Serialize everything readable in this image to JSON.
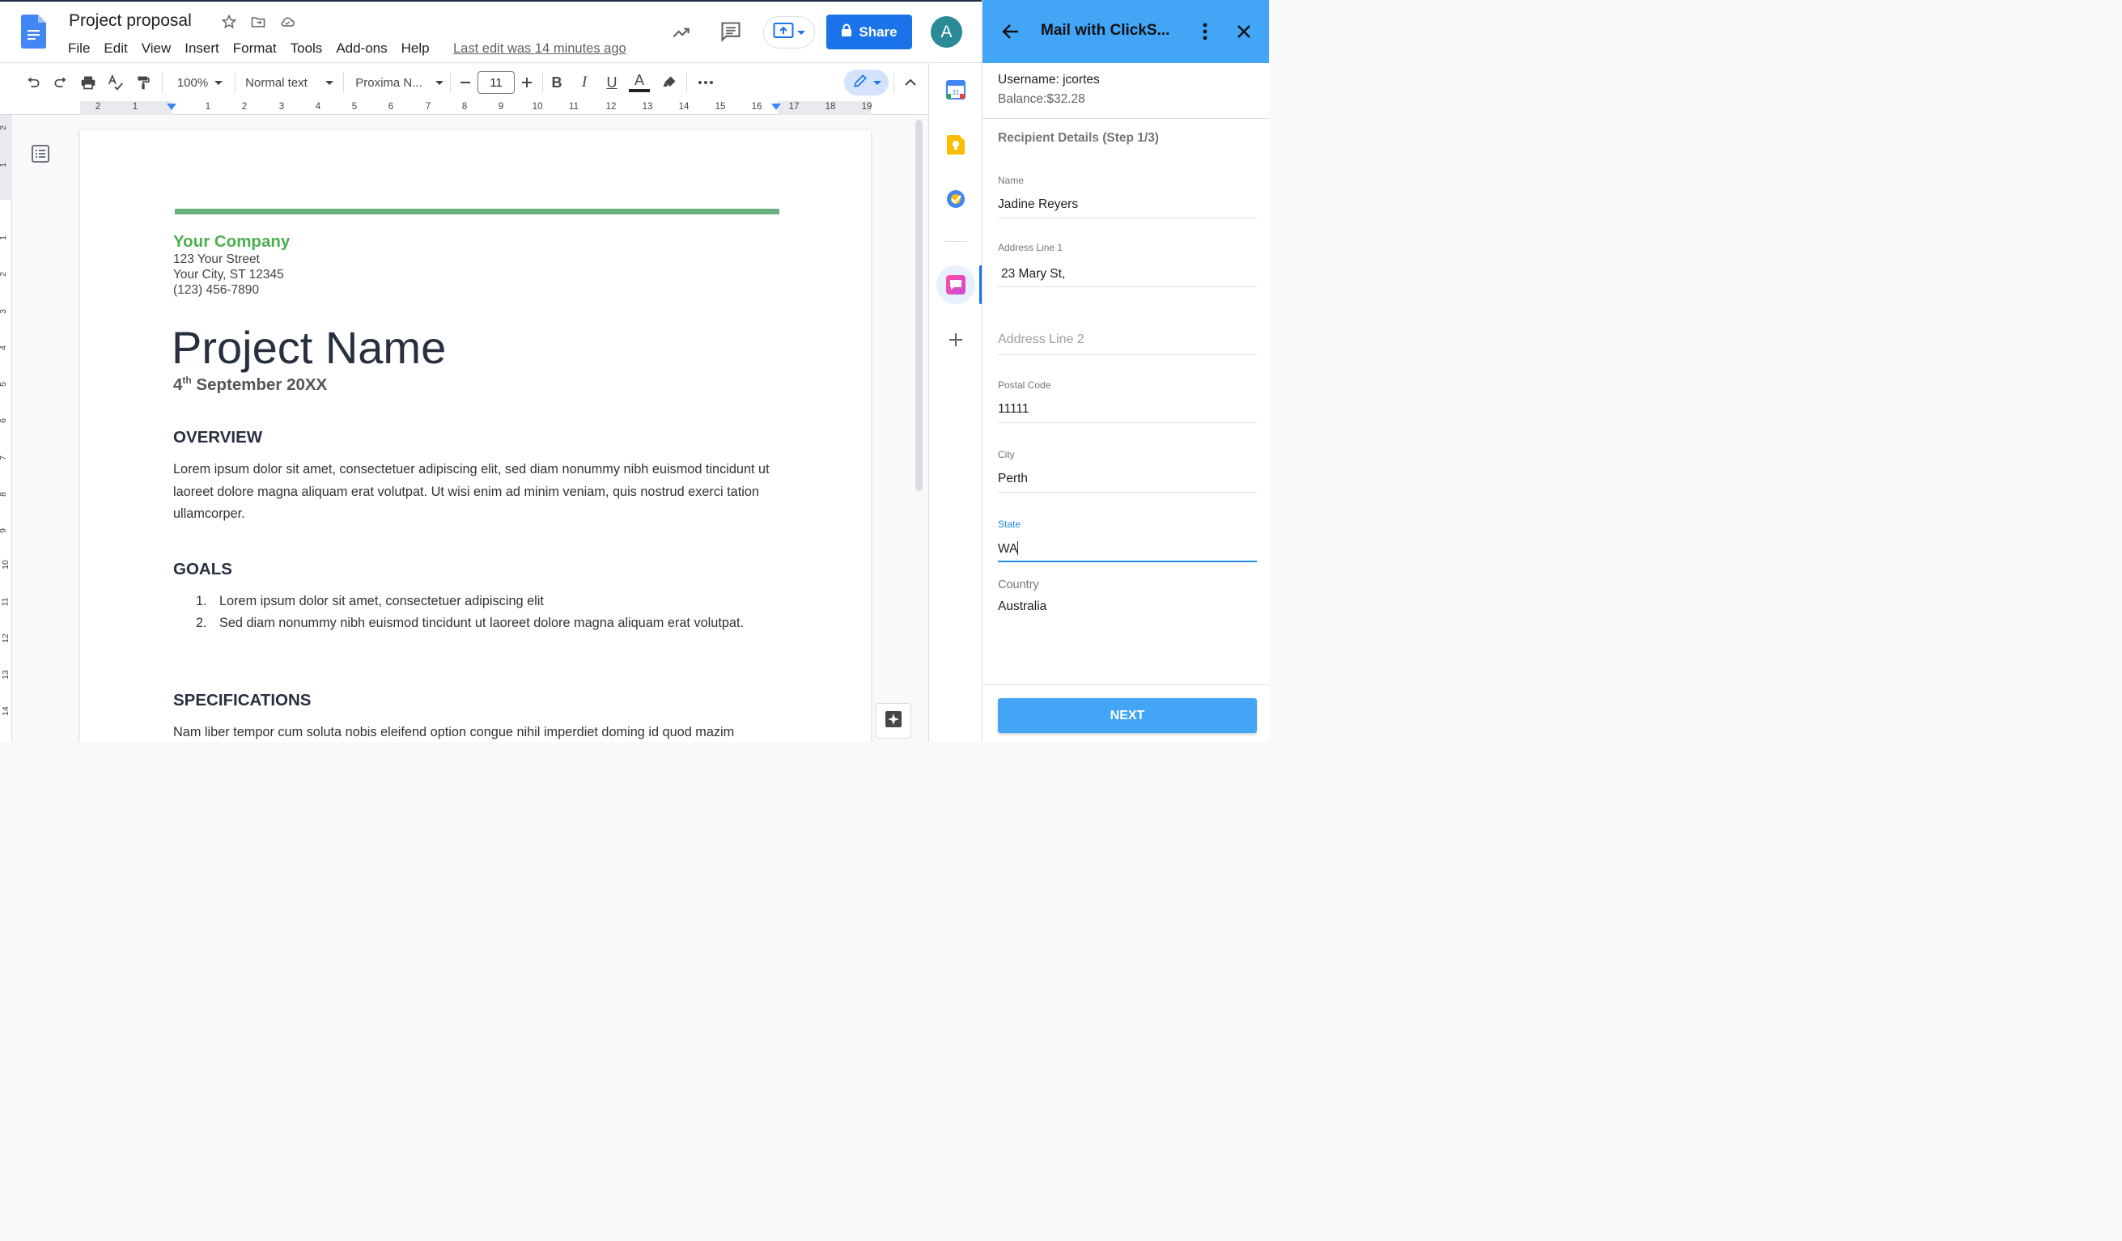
{
  "doc": {
    "title": "Project proposal",
    "menu": [
      "File",
      "Edit",
      "View",
      "Insert",
      "Format",
      "Tools",
      "Add-ons",
      "Help"
    ],
    "last_edit": "Last edit was 14 minutes ago",
    "share_label": "Share",
    "avatar_letter": "A"
  },
  "toolbar": {
    "zoom": "100%",
    "style": "Normal text",
    "font": "Proxima N...",
    "font_size": "11",
    "bold": "B",
    "italic": "I",
    "underline": "U",
    "text_color": "A"
  },
  "ruler": {
    "h_left": [
      "2",
      "1"
    ],
    "h_right": [
      "1",
      "2",
      "3",
      "4",
      "5",
      "6",
      "7",
      "8",
      "9",
      "10",
      "11",
      "12",
      "13",
      "14",
      "15",
      "16",
      "17",
      "18",
      "19"
    ],
    "v": [
      "2",
      "1",
      "1",
      "2",
      "3",
      "4",
      "5",
      "6",
      "7",
      "8",
      "9",
      "10",
      "11",
      "12",
      "13",
      "14"
    ]
  },
  "page": {
    "company": "Your Company",
    "street": "123 Your Street",
    "city": "Your City, ST 12345",
    "phone": "(123) 456-7890",
    "project_name": "Project Name",
    "date_day": "4",
    "date_suffix": "th",
    "date_rest": " September 20XX",
    "overview_heading": "OVERVIEW",
    "overview_text": "Lorem ipsum dolor sit amet, consectetuer adipiscing elit, sed diam nonummy nibh euismod tincidunt ut laoreet dolore magna aliquam erat volutpat. Ut wisi enim ad minim veniam, quis nostrud exerci tation ullamcorper.",
    "goals_heading": "GOALS",
    "goals": [
      {
        "num": "1.",
        "text": "Lorem ipsum dolor sit amet, consectetuer adipiscing elit"
      },
      {
        "num": "2.",
        "text": "Sed diam nonummy nibh euismod tincidunt ut laoreet dolore magna aliquam erat volutpat."
      }
    ],
    "specs_heading": "SPECIFICATIONS",
    "specs_text": "Nam liber tempor cum soluta nobis eleifend option congue nihil imperdiet doming id quod mazim"
  },
  "panel": {
    "title": "Mail with ClickS...",
    "username": "Username: jcortes",
    "balance": "Balance:$32.28",
    "step": "Recipient Details (Step 1/3)",
    "fields": {
      "name_label": "Name",
      "name_value": "Jadine Reyers",
      "addr1_label": "Address Line 1",
      "addr1_value": "23 Mary St,",
      "addr2_placeholder": "Address Line 2",
      "postal_label": "Postal Code",
      "postal_value": "11111",
      "city_label": "City",
      "city_value": "Perth",
      "state_label": "State",
      "state_value": "WA",
      "country_label": "Country",
      "country_value": "Australia"
    },
    "next_label": "NEXT"
  },
  "colors": {
    "accent_blue": "#1a73e8",
    "panel_blue": "#42a5f5",
    "company_green": "#4caf50"
  },
  "icons": [
    "docs-logo-icon",
    "star-icon",
    "move-to-folder-icon",
    "cloud-saved-icon",
    "activity-trend-icon",
    "comments-icon",
    "present-icon",
    "lock-icon",
    "undo-icon",
    "redo-icon",
    "print-icon",
    "spellcheck-icon",
    "paint-format-icon",
    "minus-icon",
    "plus-icon",
    "highlighter-icon",
    "more-icon",
    "pencil-icon",
    "collapse-icon",
    "outline-icon",
    "calendar-icon",
    "keep-icon",
    "tasks-icon",
    "clicksend-icon",
    "add-icon",
    "back-arrow-icon",
    "kebab-menu-icon",
    "close-icon",
    "explore-icon"
  ]
}
